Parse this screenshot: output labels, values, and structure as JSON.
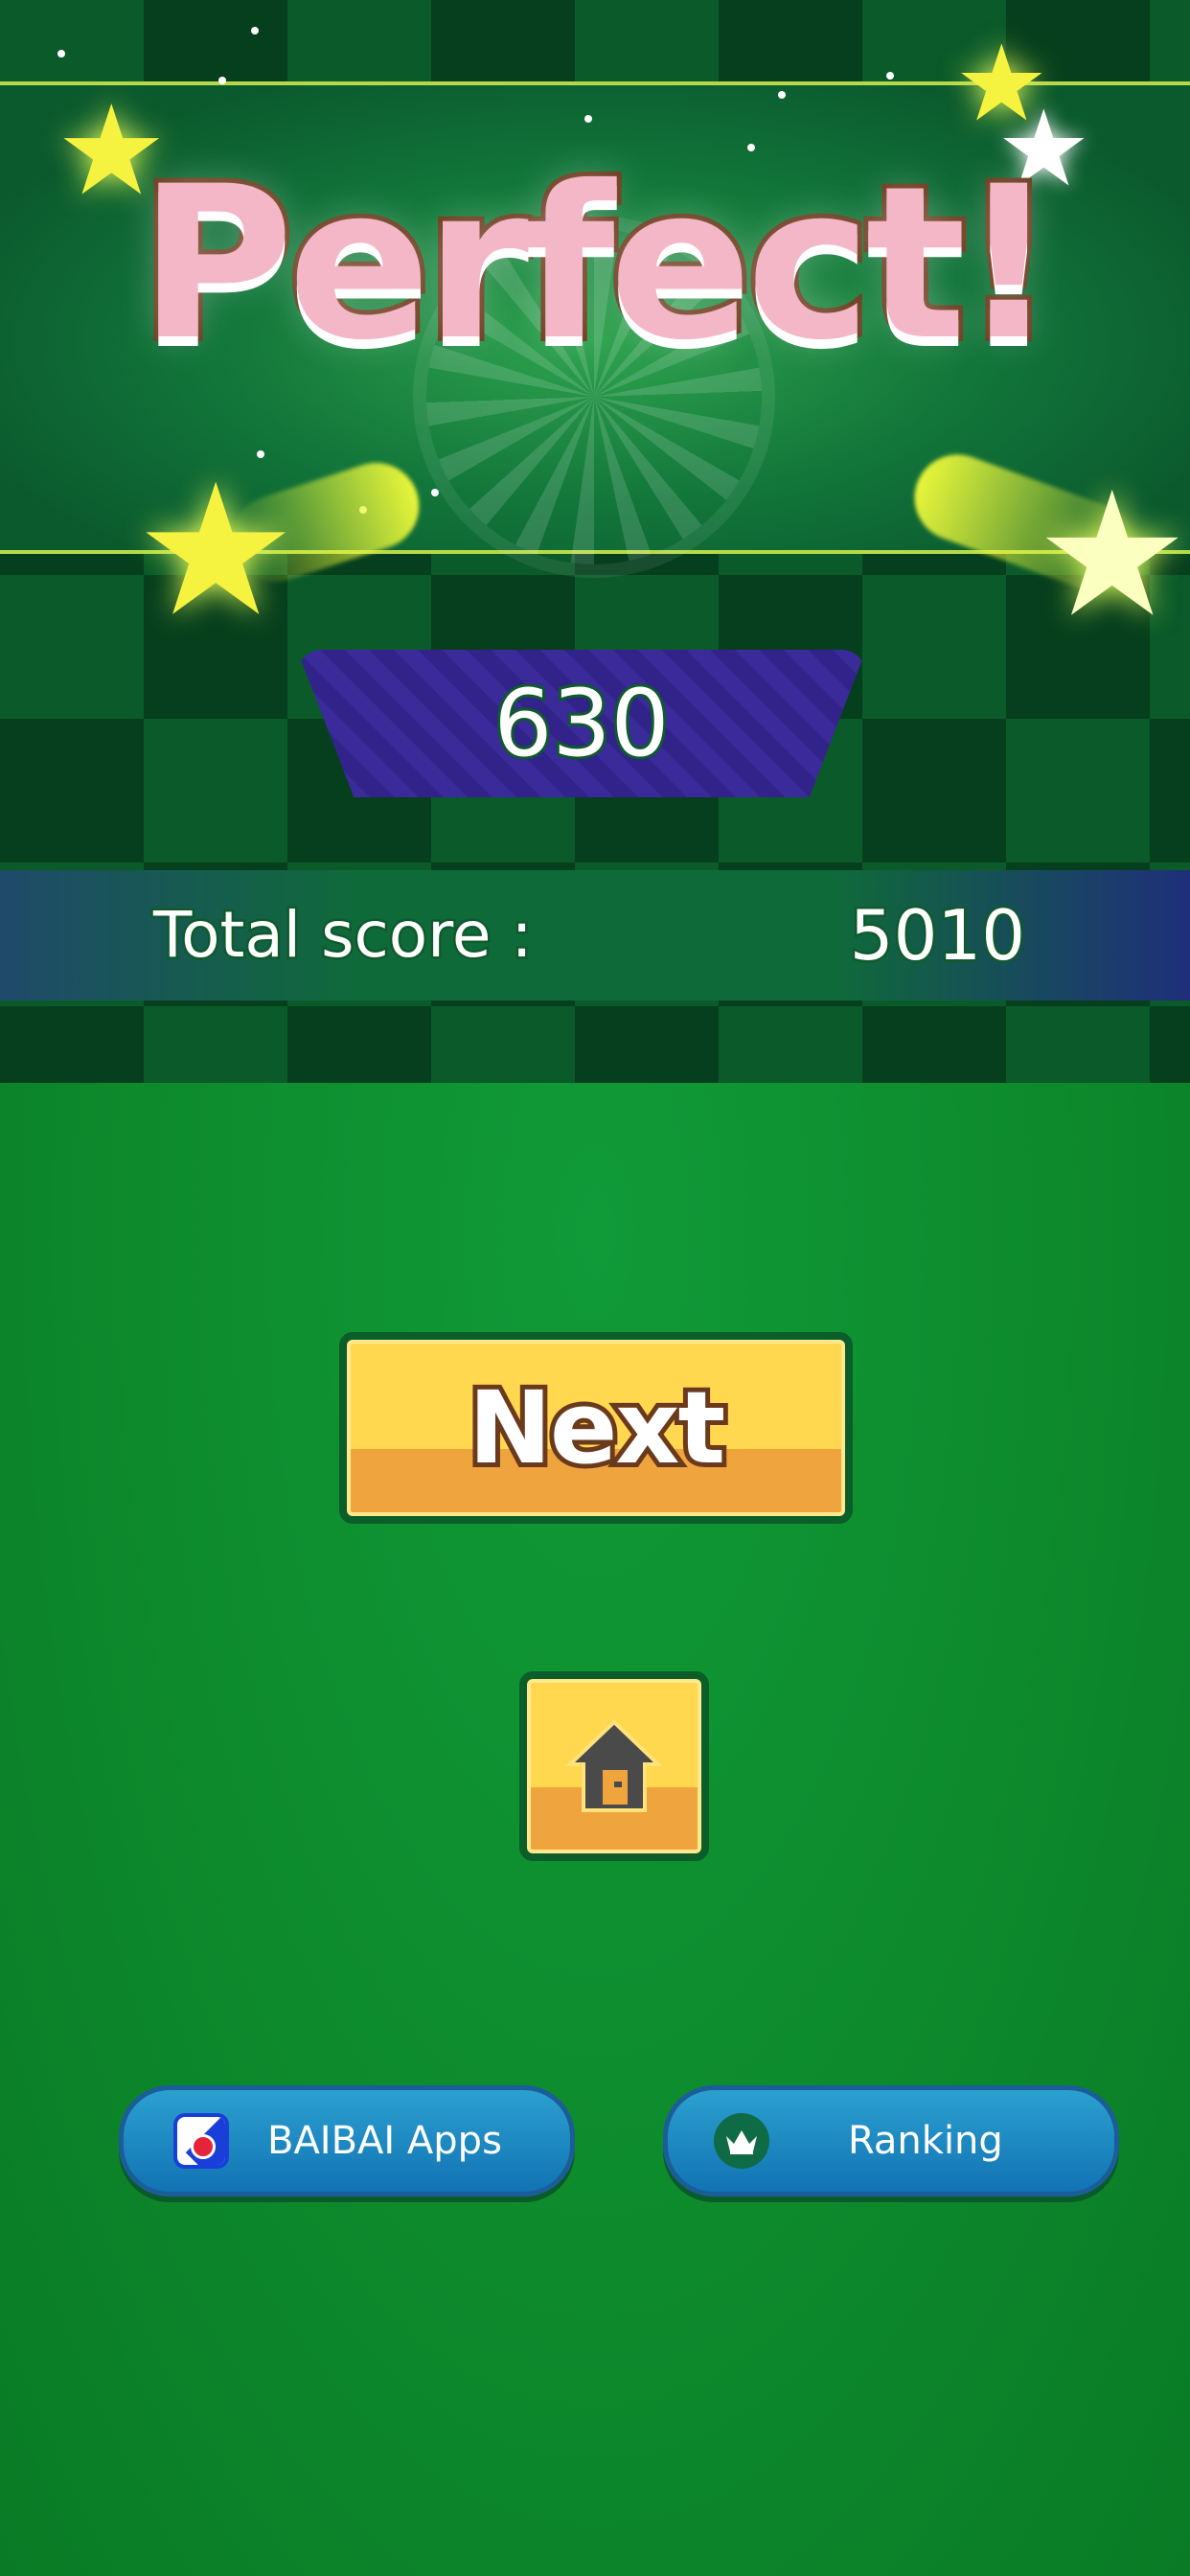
{
  "result": {
    "title": "Perfect!",
    "round_score": "630",
    "total_label": "Total score :",
    "total_value": "5010"
  },
  "buttons": {
    "next_label": "Next",
    "home_icon": "home-icon"
  },
  "footer": {
    "apps_label": "BAIBAI Apps",
    "apps_icon": "app-logo-icon",
    "ranking_label": "Ranking",
    "ranking_icon": "crown-icon"
  },
  "colors": {
    "felt_green": "#0d8a2c",
    "button_yellow": "#ffd84f",
    "pill_blue": "#1e8cc4",
    "score_purple": "#3a2a9a"
  }
}
